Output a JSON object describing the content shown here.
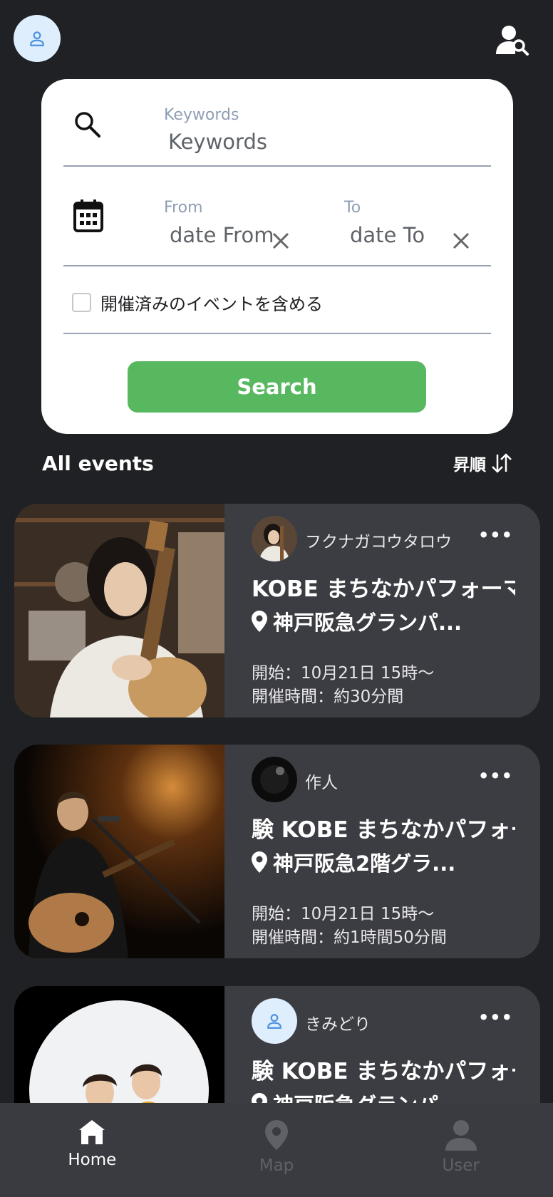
{
  "header": {
    "avatar_icon": "person-icon",
    "user_search_icon": "user-search-icon"
  },
  "search": {
    "keyword_label": "Keywords",
    "keyword_placeholder": "Keywords",
    "from_label": "From",
    "from_placeholder": "date From",
    "to_label": "To",
    "to_placeholder": "date To",
    "include_past_label": "開催済みのイベントを含める",
    "include_past_checked": false,
    "search_button": "Search"
  },
  "list": {
    "title": "All events",
    "sort_label": "昇順"
  },
  "events": [
    {
      "host": "フクナガコウタロウ",
      "title": "KOBE まちなかパフォーマンス",
      "location": "神戸阪急グランパ...",
      "start": "開始：10月21日 15時〜",
      "duration": "開催時間：約30分間",
      "more": "•••"
    },
    {
      "host": "作人",
      "title": "験  KOBE まちなかパフォーマンス",
      "location": "神戸阪急2階グラ...",
      "start": "開始：10月21日 15時〜",
      "duration": "開催時間：約1時間50分間",
      "more": "•••"
    },
    {
      "host": "きみどり",
      "title": "験  KOBE まちなかパフォーマンス",
      "location": "神戸阪急グランパ",
      "more": "•••"
    }
  ],
  "nav": {
    "home": "Home",
    "map": "Map",
    "user": "User"
  },
  "colors": {
    "background": "#202124",
    "card": "#3c3d42",
    "accent_green": "#58b85f",
    "avatar_bg": "#dfeefd",
    "avatar_icon": "#4a90e2"
  }
}
